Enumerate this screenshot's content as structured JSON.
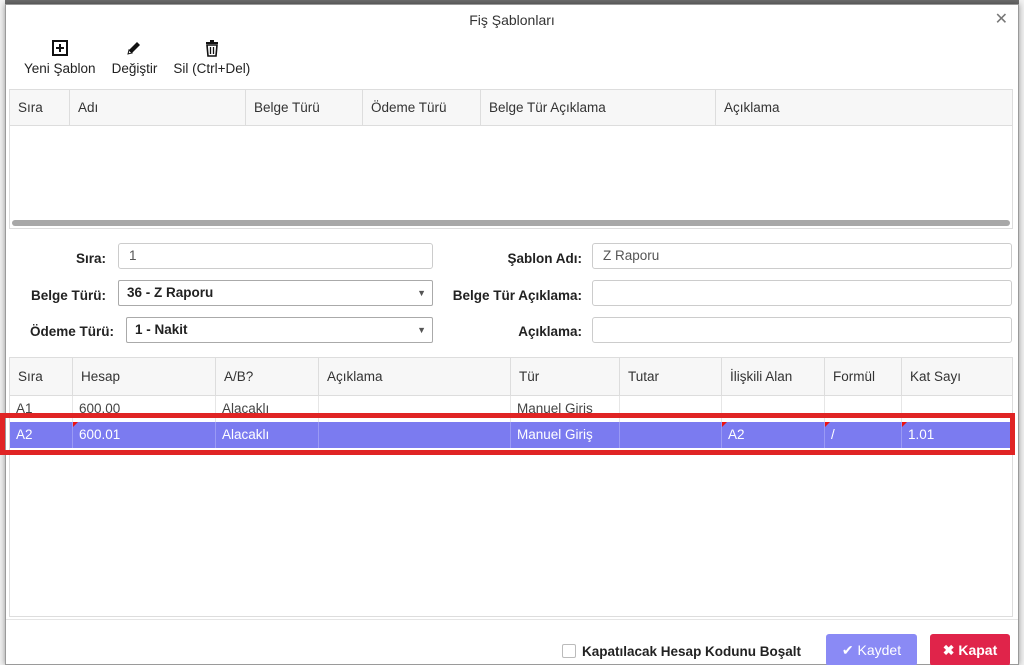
{
  "dialog": {
    "title": "Fiş Şablonları"
  },
  "toolbar": {
    "new_label": "Yeni Şablon",
    "edit_label": "Değiştir",
    "delete_label": "Sil (Ctrl+Del)"
  },
  "templates_grid": {
    "columns": [
      "Sıra",
      "Adı",
      "Belge Türü",
      "Ödeme Türü",
      "Belge Tür Açıklama",
      "Açıklama"
    ]
  },
  "form": {
    "sira_label": "Sıra:",
    "sira_value": "1",
    "sablon_adi_label": "Şablon Adı:",
    "sablon_adi_value": "Z Raporu",
    "belge_turu_label": "Belge Türü:",
    "belge_turu_value": "36 - Z Raporu",
    "belge_tur_aciklama_label": "Belge Tür Açıklama:",
    "belge_tur_aciklama_value": "",
    "odeme_turu_label": "Ödeme Türü:",
    "odeme_turu_value": "1 - Nakit",
    "aciklama_label": "Açıklama:",
    "aciklama_value": ""
  },
  "lines_grid": {
    "columns": [
      "Sıra",
      "Hesap",
      "A/B?",
      "Açıklama",
      "Tür",
      "Tutar",
      "İlişkili Alan",
      "Formül",
      "Kat Sayı"
    ],
    "rows": [
      {
        "sira": "A1",
        "hesap": "600.00",
        "ab": "Alacaklı",
        "aciklama": "",
        "tur": "Manuel Giriş",
        "tutar": "",
        "iliskili": "",
        "formul": "",
        "katsayi": ""
      },
      {
        "sira": "A2",
        "hesap": "600.01",
        "ab": "Alacaklı",
        "aciklama": "",
        "tur": "Manuel Giriş",
        "tutar": "",
        "iliskili": "A2",
        "formul": "/",
        "katsayi": "1.01"
      }
    ],
    "selected_row": 1
  },
  "footer": {
    "checkbox_label": "Kapatılacak Hesap Kodunu Boşalt",
    "checkbox_checked": false,
    "save_label": "Kaydet",
    "close_label": "Kapat"
  },
  "colors": {
    "selected_row": "#7b7bf0",
    "save_button": "#8a8af5",
    "close_button": "#e0244a",
    "highlight_box": "#e02424"
  }
}
